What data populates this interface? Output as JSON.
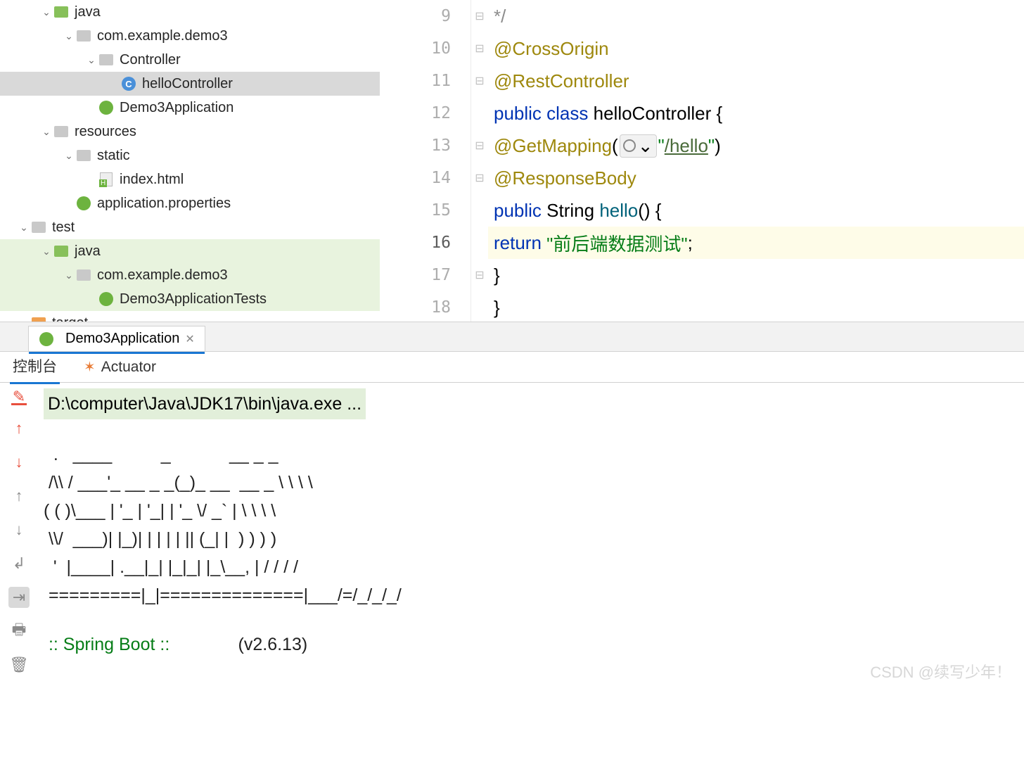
{
  "tree": {
    "java": "java",
    "pkg": "com.example.demo3",
    "controller_folder": "Controller",
    "hello_controller": "helloController",
    "demo3_app": "Demo3Application",
    "resources": "resources",
    "static": "static",
    "index_html": "index.html",
    "app_props": "application.properties",
    "test": "test",
    "test_java": "java",
    "test_pkg": "com.example.demo3",
    "demo3_tests": "Demo3ApplicationTests",
    "target": "target"
  },
  "gutter": [
    "9",
    "10",
    "11",
    "12",
    "13",
    "14",
    "15",
    "16",
    "17",
    "18"
  ],
  "code": {
    "l9": "*/",
    "l10_anno": "@CrossOrigin",
    "l11_anno": "@RestController",
    "l12_public": "public ",
    "l12_class": "class ",
    "l12_name": "helloController {",
    "l13_anno": "@GetMapping",
    "l13_paren_open": "(",
    "l13_url": "\"/hello\"",
    "l13_url_link": "/hello",
    "l13_paren_close": ")",
    "l14_anno": "@ResponseBody",
    "l15_public": "public ",
    "l15_type": "String ",
    "l15_method": "hello",
    "l15_rest": "() {",
    "l16_return": "return ",
    "l16_str": "\"前后端数据测试\"",
    "l16_semi": ";",
    "l17": "}",
    "l18": "}"
  },
  "run": {
    "tab_label": "Demo3Application",
    "subtab_console": "控制台",
    "subtab_actuator": "Actuator",
    "cmd": "D:\\computer\\Java\\JDK17\\bin\\java.exe ...",
    "ascii": "  .   ____          _            __ _ _\n /\\\\ / ___'_ __ _ _(_)_ __  __ _ \\ \\ \\ \\\n( ( )\\___ | '_ | '_| | '_ \\/ _` | \\ \\ \\ \\\n \\\\/  ___)| |_)| | | | | || (_| |  ) ) ) )\n  '  |____| .__|_| |_|_| |_\\__, | / / / /\n =========|_|==============|___/=/_/_/_/",
    "spring_label": " :: Spring Boot :: ",
    "spring_version": "             (v2.6.13)"
  },
  "watermark": "CSDN @续写少年！"
}
